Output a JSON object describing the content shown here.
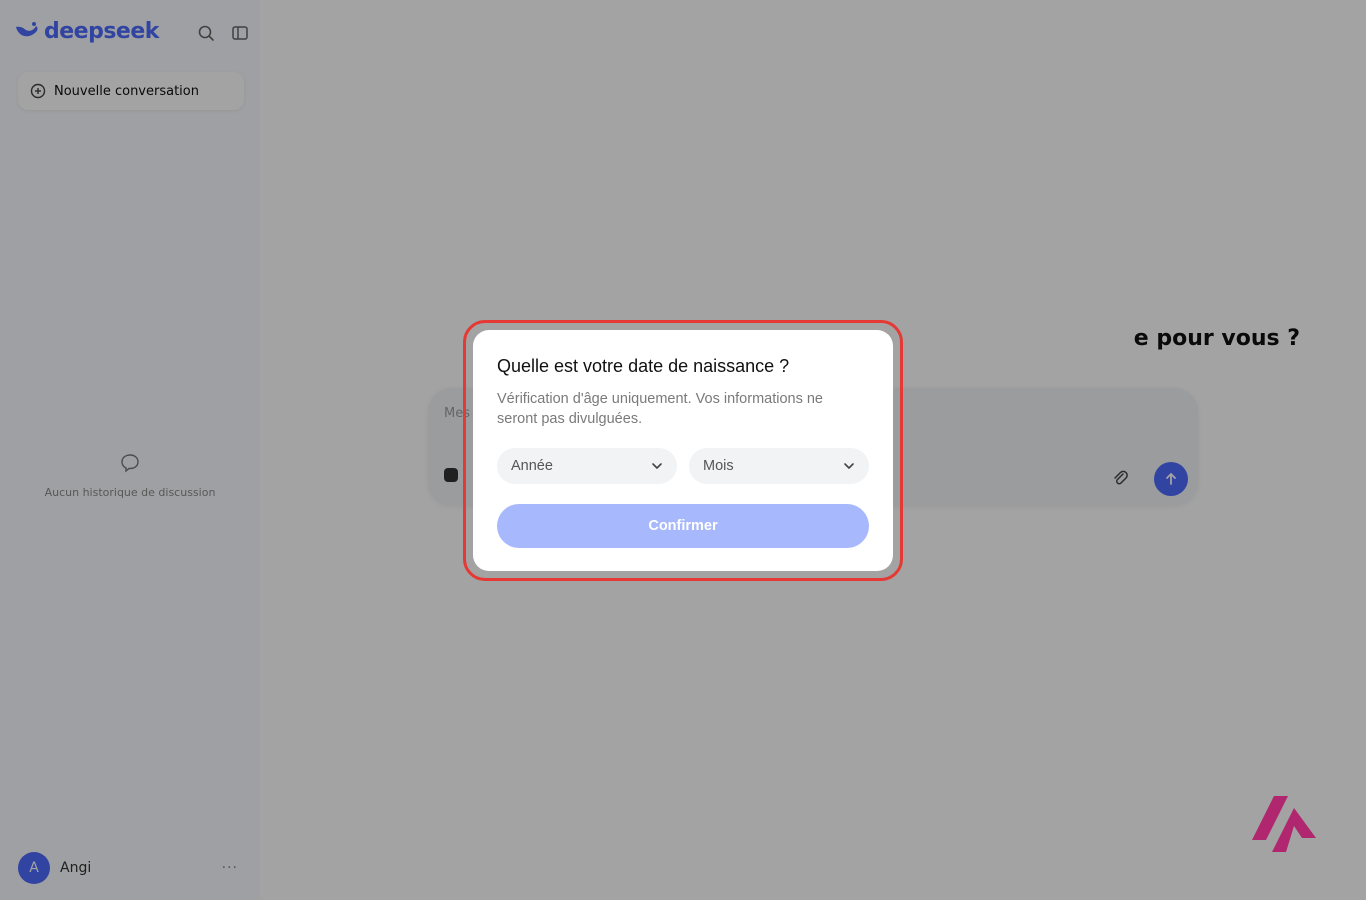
{
  "sidebar": {
    "brand_name": "deepseek",
    "new_chat_label": "Nouvelle conversation",
    "empty_history_text": "Aucun historique de discussion",
    "user": {
      "avatar_letter": "A",
      "name": "Angi"
    },
    "more_label": "···"
  },
  "main": {
    "greeting": "e pour vous ?",
    "composer_placeholder": "Mes"
  },
  "modal": {
    "title": "Quelle est votre date de naissance ?",
    "description": "Vérification d'âge uniquement. Vos informations ne seront pas divulguées.",
    "year_select": {
      "selected": "Année"
    },
    "month_select": {
      "selected": "Mois"
    },
    "confirm_label": "Confirmer"
  },
  "colors": {
    "brand": "#4d6bfe",
    "confirm_disabled": "#a7b8fd",
    "highlight_border": "#e53935",
    "watermark": "#b0266f"
  },
  "icons": {
    "search": "search-icon",
    "collapse": "sidebar-collapse-icon",
    "new_chat": "new-chat-icon",
    "chat_bubble": "chat-bubble-icon",
    "attach": "paperclip-icon",
    "send": "arrow-up-icon",
    "chevron": "chevron-down-icon"
  }
}
